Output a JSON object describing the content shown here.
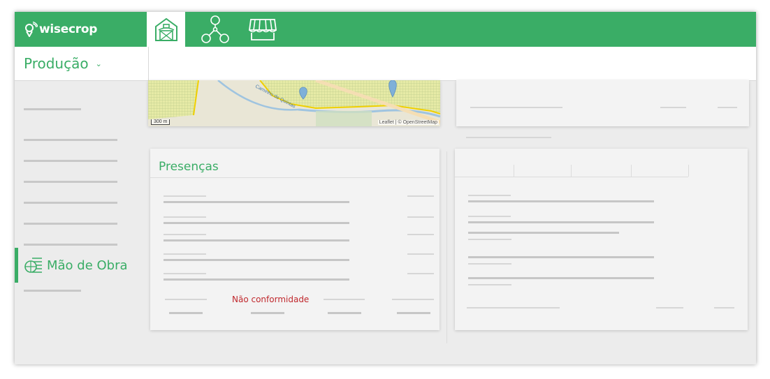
{
  "app": {
    "brand": "wisecrop",
    "colors": {
      "primary": "#3aad66",
      "alert": "#c0282d"
    },
    "nav_icons": [
      "farm-barn-icon",
      "network-nodes-icon",
      "market-stall-icon"
    ]
  },
  "subbar": {
    "module": "Produção"
  },
  "sidebar": {
    "active_item": "Mão de Obra",
    "active_icon": "workforce-icon"
  },
  "map": {
    "scale": "300 m",
    "attribution": "Leaflet | © OpenStreetMap",
    "road_label": "Caminho de Quintas"
  },
  "presencas": {
    "title": "Presenças",
    "alert_label": "Não conformidade"
  }
}
